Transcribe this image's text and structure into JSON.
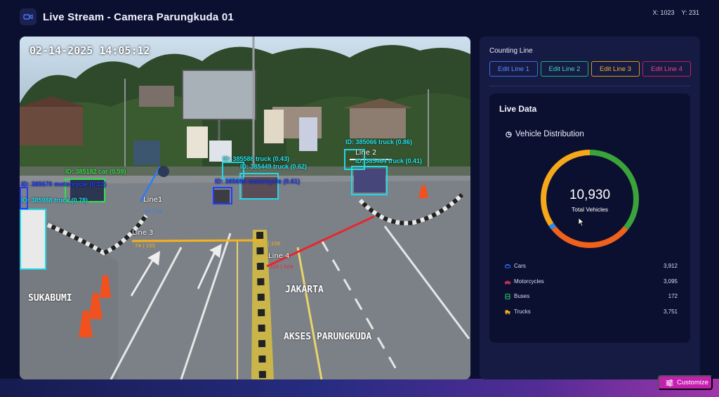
{
  "header": {
    "title": "Live Stream - Camera Parungkuda 01",
    "coord_x": "X: 1023",
    "coord_y": "Y: 231"
  },
  "video": {
    "timestamp": "02-14-2025 14:05:12",
    "detections": [
      {
        "label": "ID: 385182 car (0.59)",
        "color": "green"
      },
      {
        "label": "ID: 385670 motorcycle (0.12)",
        "color": "blue"
      },
      {
        "label": "ID: 385988 truck (0.78)",
        "color": "cyan"
      },
      {
        "label": "ID: 385588 truck (0.43)",
        "color": "cyan"
      },
      {
        "label": "ID: 385449 truck (0.62)",
        "color": "cyan"
      },
      {
        "label": "ID: 385696 motorcycle (0.61)",
        "color": "blue"
      },
      {
        "label": "ID: 385066 truck (0.86)",
        "color": "cyan"
      },
      {
        "label": "ID: 385464 truck (0.41)",
        "color": "cyan"
      }
    ],
    "lines": [
      {
        "name": "Line1",
        "count": "24 | 14",
        "color": "#2b7bff"
      },
      {
        "name": "Line 2",
        "count": "",
        "color": "#ffffff"
      },
      {
        "name": "Line 3",
        "count": "74 | 155",
        "color": "#f5b21a"
      },
      {
        "name": "Line 4",
        "count": "320 | 509",
        "color": "#e8262f"
      }
    ],
    "extra_counts": [
      "81 | 156"
    ],
    "road_text": {
      "left": "SUKABUMI",
      "center": "JAKARTA",
      "bottom": "AKSES PARUNGKUDA"
    }
  },
  "panel": {
    "counting_line_title": "Counting Line",
    "edit_buttons": [
      {
        "label": "Edit Line 1",
        "color": "#3d7bff"
      },
      {
        "label": "Edit Line 2",
        "color": "#20c997"
      },
      {
        "label": "Edit Line 3",
        "color": "#f5b21a"
      },
      {
        "label": "Edit Line 4",
        "color": "#e8265a"
      }
    ],
    "live_data_title": "Live Data",
    "distribution_title": "Vehicle Distribution",
    "total_value": "10,930",
    "total_label": "Total Vehicles",
    "legend": [
      {
        "label": "Cars",
        "value": "3,912",
        "color": "#2a6cf0",
        "icon": "car-icon"
      },
      {
        "label": "Motorcycles",
        "value": "3,095",
        "color": "#ff3d5a",
        "icon": "motorcycle-icon"
      },
      {
        "label": "Buses",
        "value": "172",
        "color": "#22c55e",
        "icon": "bus-icon"
      },
      {
        "label": "Trucks",
        "value": "3,751",
        "color": "#f5b21a",
        "icon": "truck-icon"
      }
    ]
  },
  "chart_data": {
    "type": "pie",
    "title": "Vehicle Distribution",
    "categories": [
      "Cars",
      "Motorcycles",
      "Buses",
      "Trucks"
    ],
    "values": [
      3912,
      3095,
      172,
      3751
    ],
    "colors": [
      "#3aa33a",
      "#f0621c",
      "#2a8cf0",
      "#f5a81a"
    ],
    "total": 10930
  },
  "customize_label": "Customize"
}
